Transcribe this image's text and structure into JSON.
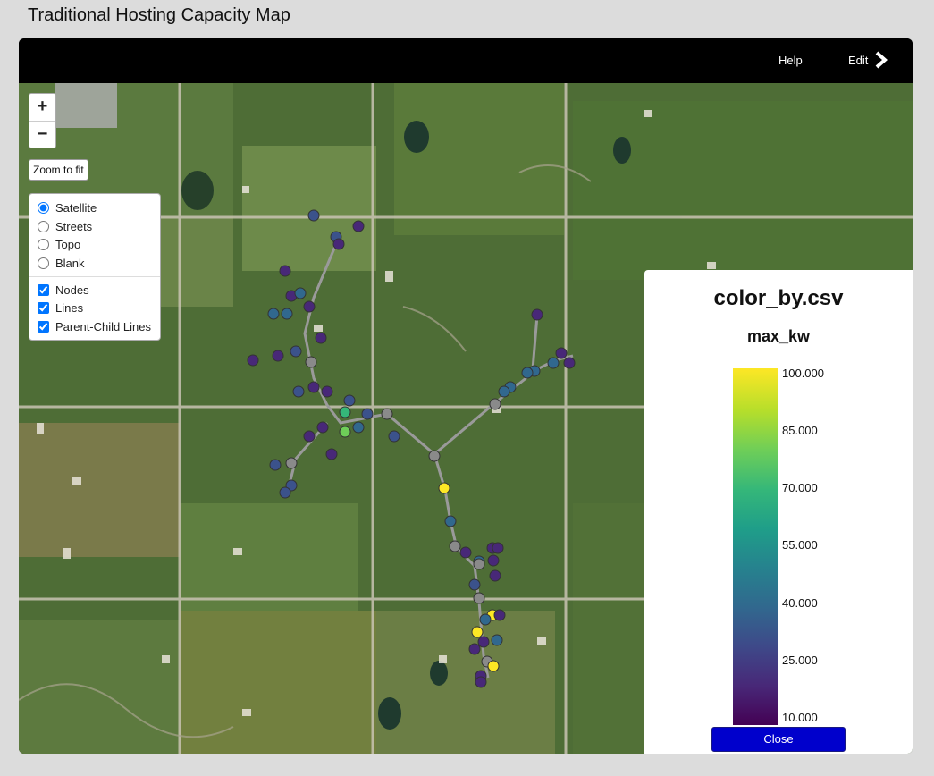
{
  "page": {
    "title": "Traditional Hosting Capacity Map"
  },
  "topbar": {
    "help_label": "Help",
    "edit_label": "Edit"
  },
  "map_controls": {
    "zoom_in": "+",
    "zoom_out": "−",
    "zoom_to_fit": "Zoom to fit",
    "base_layers": [
      {
        "label": "Satellite",
        "checked": true
      },
      {
        "label": "Streets",
        "checked": false
      },
      {
        "label": "Topo",
        "checked": false
      },
      {
        "label": "Blank",
        "checked": false
      }
    ],
    "overlays": [
      {
        "label": "Nodes",
        "checked": true
      },
      {
        "label": "Lines",
        "checked": true
      },
      {
        "label": "Parent-Child Lines",
        "checked": true
      }
    ]
  },
  "legend": {
    "title": "color_by.csv",
    "variable": "max_kw",
    "colormap": "viridis",
    "ticks": [
      "100.000",
      "85.000",
      "70.000",
      "55.000",
      "40.000",
      "25.000",
      "10.000"
    ],
    "close_label": "Close"
  },
  "colors": {
    "satellite_green": "#4a6a35",
    "null_node": "#8a8a8a",
    "close_button": "#0000cc"
  }
}
